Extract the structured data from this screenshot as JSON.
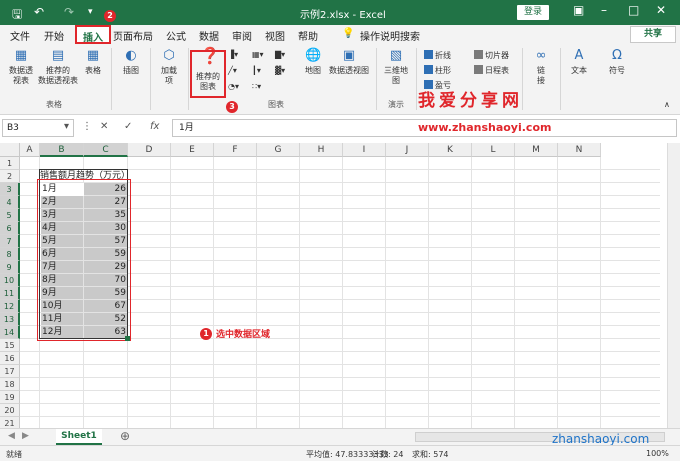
{
  "titlebar": {
    "title": "示例2.xlsx  -  Excel",
    "login": "登录",
    "save_icon": "save-icon",
    "undo_icon": "undo-icon",
    "redo_icon": "redo-icon"
  },
  "tabs": [
    "文件",
    "开始",
    "插入",
    "页面布局",
    "公式",
    "数据",
    "审阅",
    "视图",
    "帮助"
  ],
  "search_label": "操作说明搜索",
  "share_label": "共享",
  "ribbon": {
    "pivot": "数据透\n视表",
    "recommended_pivot": "推荐的\n数据透视表",
    "table": "表格",
    "group_tables": "表格",
    "illustrations": "插图",
    "addins": "加载\n项",
    "recommended_charts": "推荐的\n图表",
    "group_charts": "图表",
    "map": "地图",
    "pivot_chart": "数据透视图",
    "map3d": "三维地\n图",
    "group_demo": "演示",
    "sparkline_line": "折线",
    "sparkline_column": "柱形",
    "sparkline_winloss": "盈亏",
    "slicer": "切片器",
    "timeline": "日程表",
    "link": "链\n接",
    "text": "文本",
    "symbol": "符号"
  },
  "formula_bar": {
    "name_box": "B3",
    "formula": "1月",
    "fx": "fx"
  },
  "columns": [
    "A",
    "B",
    "C",
    "D",
    "E",
    "F",
    "G",
    "H",
    "I",
    "J",
    "K",
    "L",
    "M",
    "N"
  ],
  "rows": [
    "1",
    "2",
    "3",
    "4",
    "5",
    "6",
    "7",
    "8",
    "9",
    "10",
    "11",
    "12",
    "13",
    "14",
    "15",
    "16",
    "17",
    "18",
    "19",
    "20",
    "21"
  ],
  "table_title": "销售额月趋势（万元）",
  "table_rows": [
    {
      "month": "1月",
      "value": "26"
    },
    {
      "month": "2月",
      "value": "27"
    },
    {
      "month": "3月",
      "value": "35"
    },
    {
      "month": "4月",
      "value": "30"
    },
    {
      "month": "5月",
      "value": "57"
    },
    {
      "month": "6月",
      "value": "59"
    },
    {
      "month": "7月",
      "value": "29"
    },
    {
      "month": "8月",
      "value": "70"
    },
    {
      "month": "9月",
      "value": "59"
    },
    {
      "month": "10月",
      "value": "67"
    },
    {
      "month": "11月",
      "value": "52"
    },
    {
      "month": "12月",
      "value": "63"
    }
  ],
  "annotations": {
    "step1": "1",
    "step1_text": "选中数据区域",
    "step2": "2",
    "step3": "3"
  },
  "sheet": {
    "name": "Sheet1",
    "add": "⊕"
  },
  "status": {
    "ready": "就绪",
    "average": "平均值: 47.83333333",
    "count": "计数: 24",
    "sum": "求和: 574",
    "zoom": "100%"
  },
  "watermark": {
    "cn": "我爱分享网",
    "url": "www.zhanshaoyi.com",
    "url2": "zhanshaoyi.com"
  },
  "colors": {
    "excel_green": "#217346",
    "highlight_red": "#e0262b"
  }
}
